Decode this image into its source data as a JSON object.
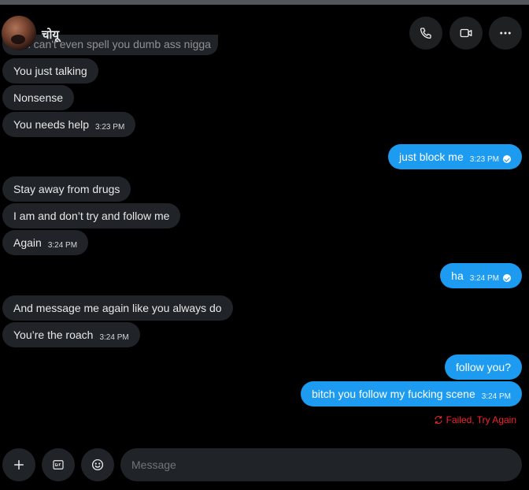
{
  "header": {
    "contact_name": "चोयू"
  },
  "messages": [
    {
      "id": "m0",
      "side": "in",
      "text": "u can't even spell you dumb ass nigga",
      "time": ""
    },
    {
      "id": "m1",
      "side": "in",
      "text": "You just talking",
      "time": ""
    },
    {
      "id": "m2",
      "side": "in",
      "text": "Nonsense",
      "time": ""
    },
    {
      "id": "m3",
      "side": "in",
      "text": "You needs help",
      "time": "3:23 PM"
    },
    {
      "id": "m4",
      "side": "out",
      "text": "just block me",
      "time": "3:23 PM",
      "read": true
    },
    {
      "id": "m5",
      "side": "in",
      "text": "Stay away from drugs",
      "time": ""
    },
    {
      "id": "m6",
      "side": "in",
      "text": "I am and don’t try and follow me",
      "time": ""
    },
    {
      "id": "m7",
      "side": "in",
      "text": "Again",
      "time": "3:24 PM"
    },
    {
      "id": "m8",
      "side": "out",
      "text": "ha",
      "time": "3:24 PM",
      "read": true
    },
    {
      "id": "m9",
      "side": "in",
      "text": "And message me again like you always do",
      "time": ""
    },
    {
      "id": "m10",
      "side": "in",
      "text": "You’re the roach",
      "time": "3:24 PM"
    },
    {
      "id": "m11",
      "side": "out",
      "text": "follow you?",
      "time": ""
    },
    {
      "id": "m12",
      "side": "out",
      "text": "bitch you follow my fucking scene",
      "time": "3:24 PM"
    }
  ],
  "status": {
    "failed_text": "Failed, Try Again"
  },
  "composer": {
    "placeholder": "Message"
  },
  "icons": {
    "call": "phone-icon",
    "video": "video-icon",
    "more": "more-icon",
    "add": "plus-icon",
    "gif": "gif-icon",
    "emoji": "emoji-icon",
    "retry": "retry-icon"
  },
  "colors": {
    "background": "#000000",
    "incoming_bubble": "#202327",
    "outgoing_bubble": "#1d9bf0",
    "error": "#f4212e"
  }
}
